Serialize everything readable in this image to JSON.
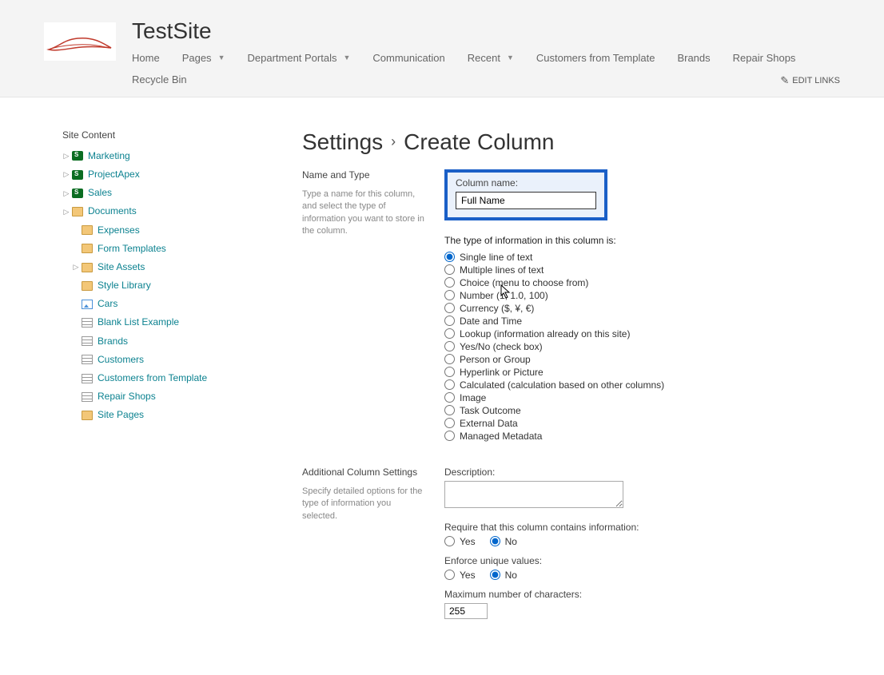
{
  "site": {
    "title": "TestSite"
  },
  "nav": {
    "items": [
      {
        "label": "Home",
        "dropdown": false
      },
      {
        "label": "Pages",
        "dropdown": true
      },
      {
        "label": "Department Portals",
        "dropdown": true
      },
      {
        "label": "Communication",
        "dropdown": false
      },
      {
        "label": "Recent",
        "dropdown": true
      },
      {
        "label": "Customers from Template",
        "dropdown": false
      },
      {
        "label": "Brands",
        "dropdown": false
      },
      {
        "label": "Repair Shops",
        "dropdown": false
      },
      {
        "label": "Recycle Bin",
        "dropdown": false
      }
    ],
    "edit_links": "EDIT LINKS"
  },
  "sidebar": {
    "title": "Site Content",
    "items": [
      {
        "label": "Marketing",
        "icon": "sp",
        "expandable": true
      },
      {
        "label": "ProjectApex",
        "icon": "sp",
        "expandable": true
      },
      {
        "label": "Sales",
        "icon": "sp",
        "expandable": true
      },
      {
        "label": "Documents",
        "icon": "folder",
        "expandable": true
      },
      {
        "label": "Expenses",
        "icon": "folder",
        "expandable": false,
        "indent": true
      },
      {
        "label": "Form Templates",
        "icon": "folder",
        "expandable": false,
        "indent": true
      },
      {
        "label": "Site Assets",
        "icon": "folder",
        "expandable": true,
        "indent": true
      },
      {
        "label": "Style Library",
        "icon": "folder",
        "expandable": false,
        "indent": true
      },
      {
        "label": "Cars",
        "icon": "img",
        "expandable": false,
        "indent": true
      },
      {
        "label": "Blank List Example",
        "icon": "list",
        "expandable": false,
        "indent": true
      },
      {
        "label": "Brands",
        "icon": "list",
        "expandable": false,
        "indent": true
      },
      {
        "label": "Customers",
        "icon": "list",
        "expandable": false,
        "indent": true
      },
      {
        "label": "Customers from Template",
        "icon": "list",
        "expandable": false,
        "indent": true
      },
      {
        "label": "Repair Shops",
        "icon": "list",
        "expandable": false,
        "indent": true
      },
      {
        "label": "Site Pages",
        "icon": "folder",
        "expandable": false,
        "indent": true
      }
    ]
  },
  "page": {
    "breadcrumb_root": "Settings",
    "breadcrumb_leaf": "Create Column",
    "name_type": {
      "section_label": "Name and Type",
      "help": "Type a name for this column, and select the type of information you want to store in the column.",
      "column_name_label": "Column name:",
      "column_name_value": "Full Name",
      "type_prompt": "The type of information in this column is:",
      "types": [
        "Single line of text",
        "Multiple lines of text",
        "Choice (menu to choose from)",
        "Number (1, 1.0, 100)",
        "Currency ($, ¥, €)",
        "Date and Time",
        "Lookup (information already on this site)",
        "Yes/No (check box)",
        "Person or Group",
        "Hyperlink or Picture",
        "Calculated (calculation based on other columns)",
        "Image",
        "Task Outcome",
        "External Data",
        "Managed Metadata"
      ],
      "selected_type_index": 0
    },
    "additional": {
      "section_label": "Additional Column Settings",
      "help": "Specify detailed options for the type of information you selected.",
      "description_label": "Description:",
      "description_value": "",
      "require_label": "Require that this column contains information:",
      "require_yes": "Yes",
      "require_no": "No",
      "require_selected": "no",
      "unique_label": "Enforce unique values:",
      "unique_yes": "Yes",
      "unique_no": "No",
      "unique_selected": "no",
      "maxchars_label": "Maximum number of characters:",
      "maxchars_value": "255"
    }
  }
}
